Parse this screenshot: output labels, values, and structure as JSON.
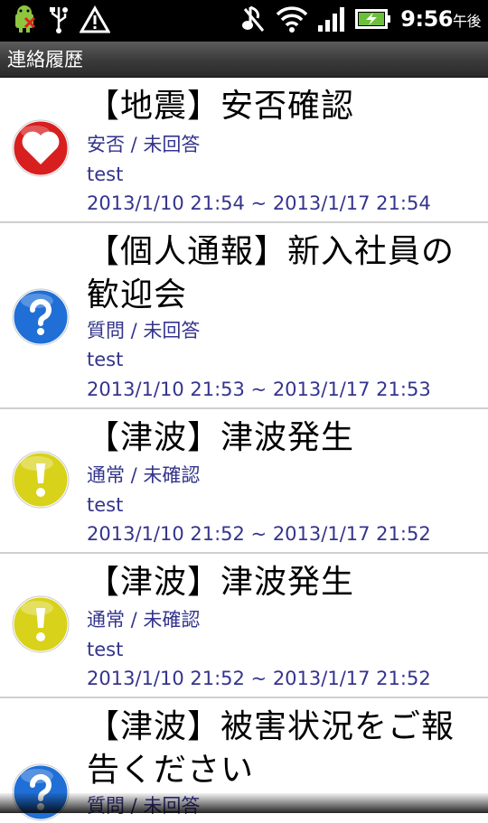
{
  "status_bar": {
    "time": "9:56",
    "ampm": "午後",
    "icons_left": [
      "android-debug-icon",
      "usb-icon",
      "warning-icon"
    ],
    "icons_right": [
      "mute-icon",
      "wifi-icon",
      "signal-icon",
      "battery-charging-icon"
    ]
  },
  "header": {
    "title": "連絡履歴"
  },
  "items": [
    {
      "icon": "heart-icon",
      "icon_color": "#e02626",
      "title": "【地震】安否確認",
      "type_status": "安否 / 未回答",
      "body": "test",
      "period": "2013/1/10 21:54 ~ 2013/1/17 21:54"
    },
    {
      "icon": "question-icon",
      "icon_color": "#1f6fd6",
      "title": "【個人通報】新入社員の歓迎会",
      "type_status": "質問 / 未回答",
      "body": "test",
      "period": "2013/1/10 21:53 ~ 2013/1/17 21:53"
    },
    {
      "icon": "exclamation-icon",
      "icon_color": "#d8d21a",
      "title": "【津波】津波発生",
      "type_status": "通常 / 未確認",
      "body": "test",
      "period": "2013/1/10 21:52 ~ 2013/1/17 21:52"
    },
    {
      "icon": "exclamation-icon",
      "icon_color": "#d8d21a",
      "title": "【津波】津波発生",
      "type_status": "通常 / 未確認",
      "body": "test",
      "period": "2013/1/10 21:52 ~ 2013/1/17 21:52"
    },
    {
      "icon": "question-icon",
      "icon_color": "#1f6fd6",
      "title": "【津波】被害状況をご報告ください",
      "type_status": "質問 / 未回答",
      "body": "",
      "period": ""
    }
  ]
}
